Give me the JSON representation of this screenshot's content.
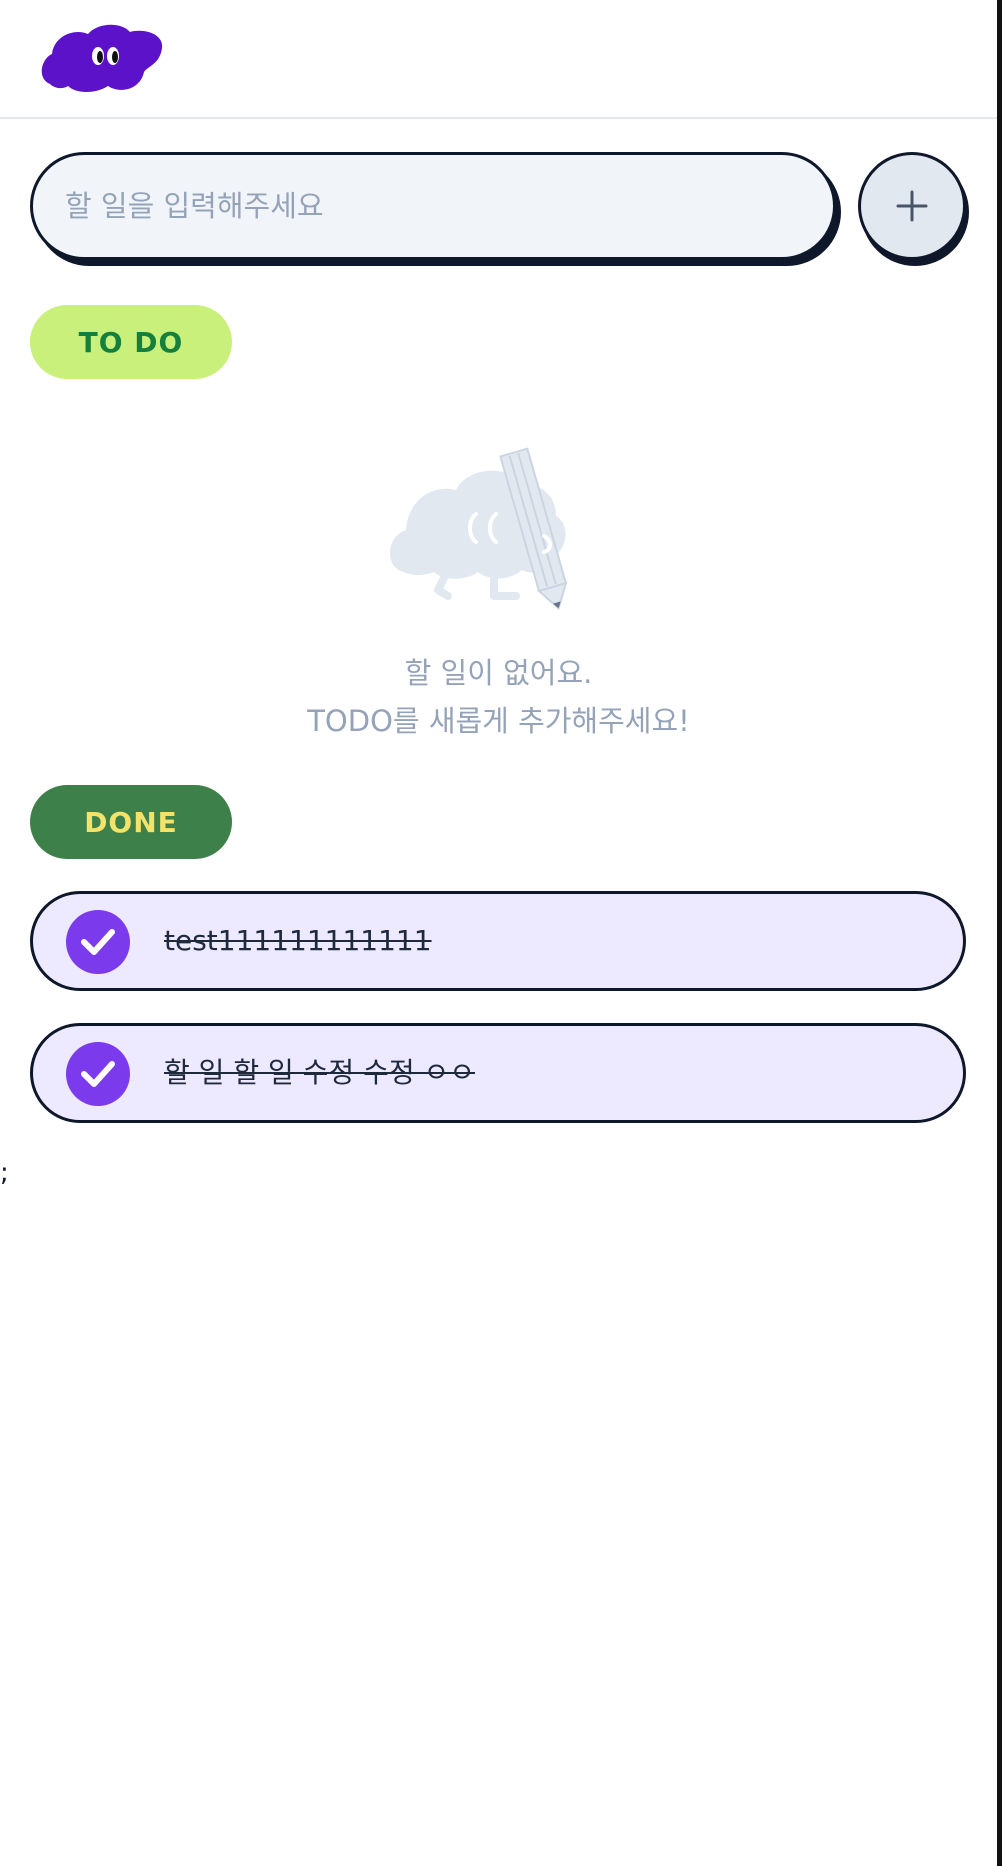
{
  "header": {
    "logo_icon": "cloud-face-logo-icon",
    "logo_color": "#5b12c9"
  },
  "todo_input": {
    "placeholder": "할 일을 입력해주세요",
    "value": ""
  },
  "add_button": {
    "symbol": "+",
    "icon": "plus-icon"
  },
  "todo_section": {
    "label": "TO DO",
    "empty_icon": "cloud-with-pencil-icon",
    "empty_line1": "할 일이 없어요.",
    "empty_line2": "TODO를 새롭게 추가해주세요!"
  },
  "done_section": {
    "label": "DONE",
    "items": [
      {
        "text": "test111111111111",
        "done": true,
        "icon": "checkmark-icon"
      },
      {
        "text": "할 일 할 일 수정 수정 ㅇㅇ",
        "done": true,
        "icon": "checkmark-icon"
      }
    ]
  },
  "stray_text": ";",
  "colors": {
    "accent_purple": "#7c3aed",
    "done_item_bg": "#ede9fe",
    "todo_chip_bg": "#c9f07a",
    "todo_chip_text": "#15803d",
    "done_chip_bg": "#3e8049",
    "done_chip_text": "#f4e36a",
    "outline": "#0f172a",
    "muted_text": "#94a3b8"
  }
}
